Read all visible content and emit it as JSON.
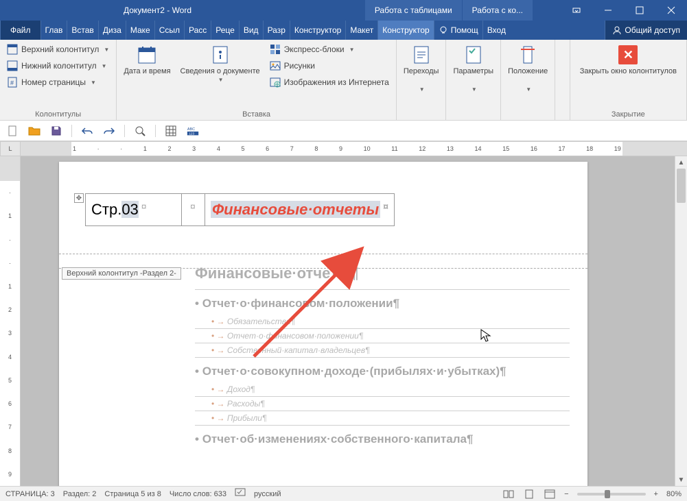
{
  "titlebar": {
    "title": "Документ2 - Word",
    "context_tabs": [
      "Работа с таблицами",
      "Работа с ко..."
    ]
  },
  "tabs": {
    "file": "Файл",
    "items": [
      "Глав",
      "Встав",
      "Диза",
      "Маке",
      "Ссыл",
      "Расс",
      "Реце",
      "Вид",
      "Разр",
      "Конструктор",
      "Макет"
    ],
    "active": "Конструктор",
    "help": "Помощ",
    "signin": "Вход",
    "share": "Общий доступ"
  },
  "ribbon": {
    "group1": {
      "label": "Колонтитулы",
      "items": [
        "Верхний колонтитул",
        "Нижний колонтитул",
        "Номер страницы"
      ]
    },
    "group2": {
      "date": "Дата и время",
      "docinfo": "Сведения о документе",
      "express": "Экспресс-блоки",
      "pictures": "Рисунки",
      "webimg": "Изображения из Интернета",
      "label": "Вставка"
    },
    "group3": {
      "nav": "Переходы"
    },
    "group4": {
      "opts": "Параметры"
    },
    "group5": {
      "pos": "Положение"
    },
    "group6": {
      "close": "Закрыть окно колонтитулов",
      "label": "Закрытие"
    }
  },
  "ruler_corner": "L",
  "page": {
    "header_left_prefix": "Стр.",
    "header_left_num": "03",
    "header_right": "Финансовые·отчеты",
    "header_label": "Верхний колонтитул -Раздел 2-"
  },
  "doc": {
    "h1": "Финансовые·отчеты¶",
    "s1": "Отчет·о·финансовом·положении¶",
    "s1_items": [
      "Обязательства¶",
      "Отчет·о·финансовом·положении¶",
      "Собственный·капитал·владельцев¶"
    ],
    "s2": "Отчет·о·совокупном·доходе·(прибылях·и·убытках)¶",
    "s2_items": [
      "Доход¶",
      "Расходы¶",
      "Прибыли¶"
    ],
    "s3": "Отчет·об·изменениях·собственного·капитала¶"
  },
  "status": {
    "page": "СТРАНИЦА: 3",
    "section": "Раздел: 2",
    "pages": "Страница 5 из 8",
    "words": "Число слов: 633",
    "lang": "русский",
    "zoom": "80%"
  }
}
